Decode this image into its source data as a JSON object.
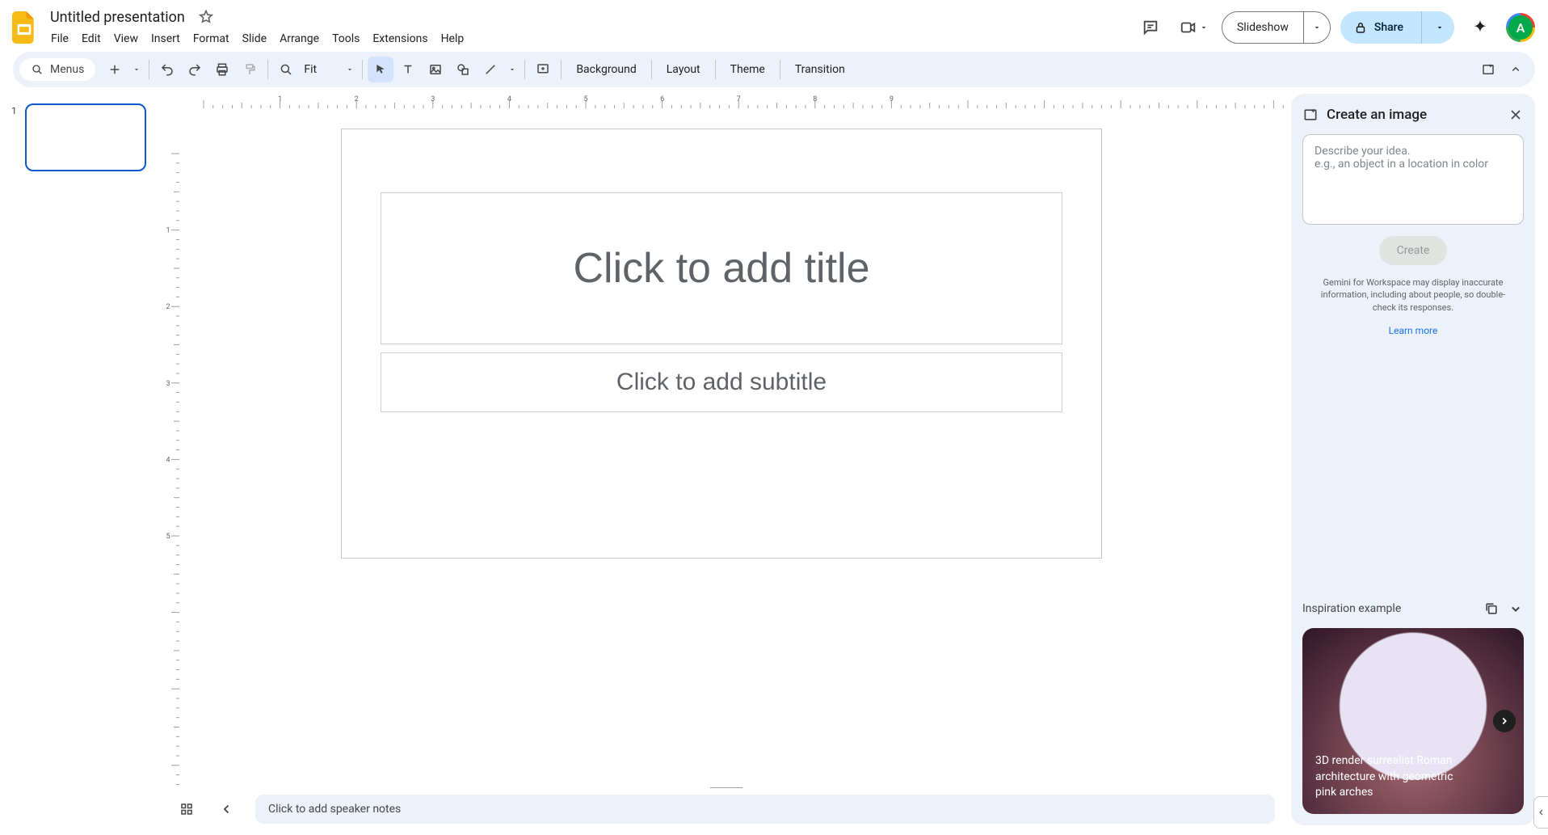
{
  "doc": {
    "name": "Untitled presentation"
  },
  "menus": [
    "File",
    "Edit",
    "View",
    "Insert",
    "Format",
    "Slide",
    "Arrange",
    "Tools",
    "Extensions",
    "Help"
  ],
  "headerButtons": {
    "slideshow": "Slideshow",
    "share": "Share"
  },
  "avatarInitial": "A",
  "toolbar": {
    "menusChip": "Menus",
    "zoom": "Fit",
    "background": "Background",
    "layout": "Layout",
    "theme": "Theme",
    "transition": "Transition"
  },
  "filmstrip": {
    "slides": [
      {
        "num": "1"
      }
    ]
  },
  "slide": {
    "titlePlaceholder": "Click to add title",
    "subtitlePlaceholder": "Click to add subtitle"
  },
  "speakerNotesPlaceholder": "Click to add speaker notes",
  "sidepanel": {
    "title": "Create an image",
    "inputPlaceholder": "Describe your idea.\ne.g., an object in a location in color",
    "createLabel": "Create",
    "disclaimer": "Gemini for Workspace may display inaccurate information, including about people, so double-check its responses.",
    "learnMore": "Learn more",
    "inspirationTitle": "Inspiration example",
    "inspirationText": "3D render surrealist Roman architecture with geometric pink arches"
  },
  "rulerH": [
    "1",
    "2",
    "3",
    "4",
    "5",
    "6",
    "7",
    "8",
    "9"
  ],
  "rulerV": [
    "1",
    "2",
    "3",
    "4",
    "5"
  ]
}
